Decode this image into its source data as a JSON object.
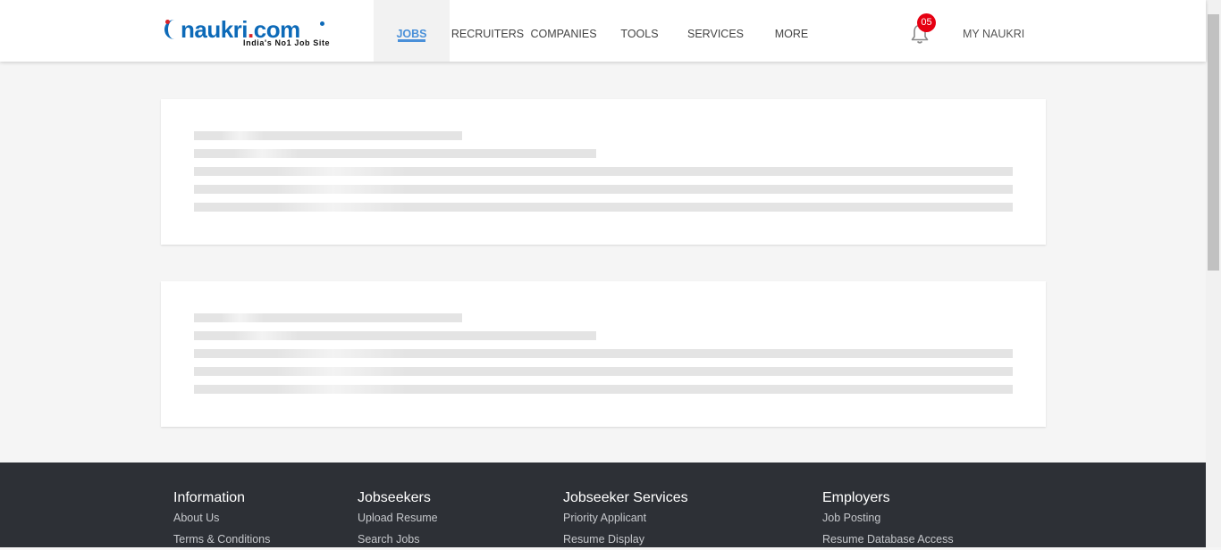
{
  "logo": {
    "name": "naukri.com",
    "tagline": "India's No1 Job Site"
  },
  "nav": [
    {
      "label": "JOBS",
      "active": true
    },
    {
      "label": "RECRUITERS"
    },
    {
      "label": "COMPANIES"
    },
    {
      "label": "TOOLS"
    },
    {
      "label": "SERVICES"
    },
    {
      "label": "MORE"
    }
  ],
  "notifications": {
    "count": "05",
    "icon": "bell-icon"
  },
  "my_naukri": "MY NAUKRI",
  "colors": {
    "accent": "#4a90d9",
    "badge": "#e60012",
    "brand_blue": "#0d6ab8",
    "footer_bg": "#2d3036"
  },
  "footer": {
    "columns": [
      {
        "heading": "Information",
        "links": [
          "About Us",
          "Terms & Conditions"
        ]
      },
      {
        "heading": "Jobseekers",
        "links": [
          "Upload Resume",
          "Search Jobs"
        ]
      },
      {
        "heading": "Jobseeker Services",
        "links": [
          "Priority Applicant",
          "Resume Display"
        ]
      },
      {
        "heading": "Employers",
        "links": [
          "Job Posting",
          "Resume Database Access"
        ]
      }
    ]
  }
}
